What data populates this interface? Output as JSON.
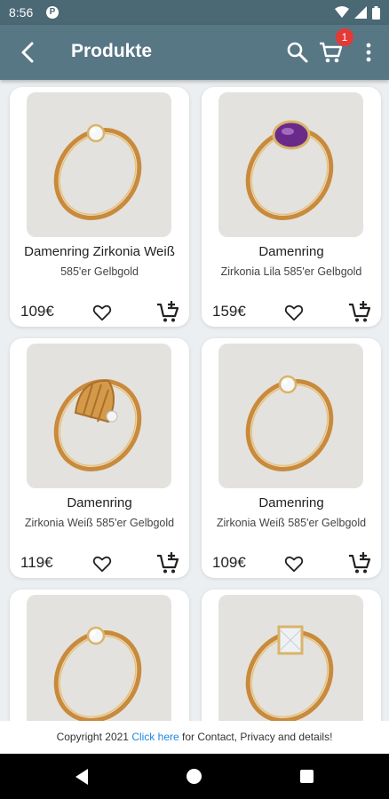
{
  "status_bar": {
    "time": "8:56"
  },
  "app_bar": {
    "title": "Produkte",
    "cart_count": "1"
  },
  "products": [
    {
      "name": "Damenring Zirkonia Weiß",
      "desc": "585'er Gelbgold",
      "price": "109€",
      "stone": "clear"
    },
    {
      "name": "Damenring",
      "desc": "Zirkonia Lila 585'er Gelbgold",
      "price": "159€",
      "stone": "purple"
    },
    {
      "name": "Damenring",
      "desc": "Zirkonia Weiß 585'er Gelbgold",
      "price": "119€",
      "stone": "shell"
    },
    {
      "name": "Damenring",
      "desc": "Zirkonia Weiß 585'er Gelbgold",
      "price": "109€",
      "stone": "clear"
    },
    {
      "name": "",
      "desc": "",
      "price": "",
      "stone": "clear"
    },
    {
      "name": "",
      "desc": "",
      "price": "",
      "stone": "rect"
    }
  ],
  "footer": {
    "prefix": "Copyright 2021 ",
    "link": "Click here",
    "suffix": " for Contact, Privacy and details!"
  },
  "colors": {
    "app_bar": "#587785",
    "status_bar": "#4b6875",
    "badge": "#e53935",
    "link": "#1e88e5",
    "gold": "#c98a3c"
  }
}
